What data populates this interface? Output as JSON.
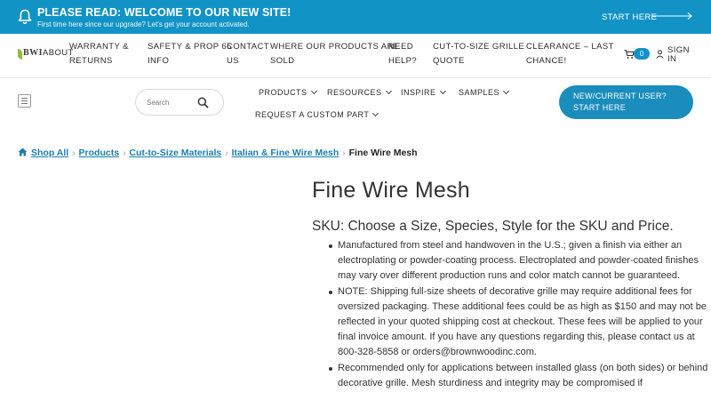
{
  "announcement": {
    "title": "PLEASE READ: WELCOME TO OUR NEW SITE!",
    "subtitle": "First time here since our upgrade? Let's get your account activated.",
    "cta_label": "START HERE",
    "icons": [
      "bell-icon",
      "arrow-right-icon"
    ]
  },
  "topnav": {
    "logo_text": "BWI",
    "items": [
      {
        "line1": "ABOUT",
        "line2": ""
      },
      {
        "line1": "WARRANTY &",
        "line2": "RETURNS"
      },
      {
        "line1": "SAFETY & PROP 65",
        "line2": "INFO"
      },
      {
        "line1": "CONTACT",
        "line2": "US"
      },
      {
        "line1": "WHERE OUR PRODUCTS ARE",
        "line2": "SOLD"
      },
      {
        "line1": "NEED",
        "line2": "HELP?"
      },
      {
        "line1": "CUT-TO-SIZE GRILLE",
        "line2": "QUOTE"
      },
      {
        "line1": "CLEARANCE – LAST",
        "line2": "CHANCE!"
      }
    ],
    "cart_count": "0",
    "signin_line1": "SIGN",
    "signin_line2": "IN"
  },
  "mainnav": {
    "search_placeholder": "Search",
    "items": [
      "PRODUCTS",
      "RESOURCES",
      "INSPIRE",
      "SAMPLES",
      "REQUEST A CUSTOM PART"
    ],
    "cta_line1": "NEW/CURRENT USER?",
    "cta_line2": "START HERE"
  },
  "breadcrumb": {
    "items": [
      "Shop All",
      "Products",
      "Cut-to-Size Materials",
      "Italian & Fine Wire Mesh"
    ],
    "current": "Fine Wire Mesh"
  },
  "product": {
    "title": "Fine Wire Mesh",
    "sku_text": "SKU: Choose a Size, Species, Style for the SKU and Price.",
    "bullets": [
      "Manufactured from steel and handwoven in the U.S.; given a finish via either an electroplating or powder-coating process. Electroplated and powder-coated finishes may vary over different production runs and color match cannot be guaranteed.",
      "NOTE: Shipping full-size sheets of decorative grille may require additional fees for oversized packaging. These additional fees could be as high as $150 and may not be reflected in your quoted shipping cost at checkout. These fees will be applied to your final invoice amount. If you have any questions regarding this, please contact us at 800-328-5858 or orders@brownwoodinc.com.",
      "Recommended only for applications between installed glass (on both sides) or behind decorative grille. Mesh sturdiness and integrity may be compromised if"
    ]
  },
  "colors": {
    "brand_blue": "#1293c6",
    "cta_blue": "#1a8dbd",
    "link_blue": "#1a7fae"
  }
}
